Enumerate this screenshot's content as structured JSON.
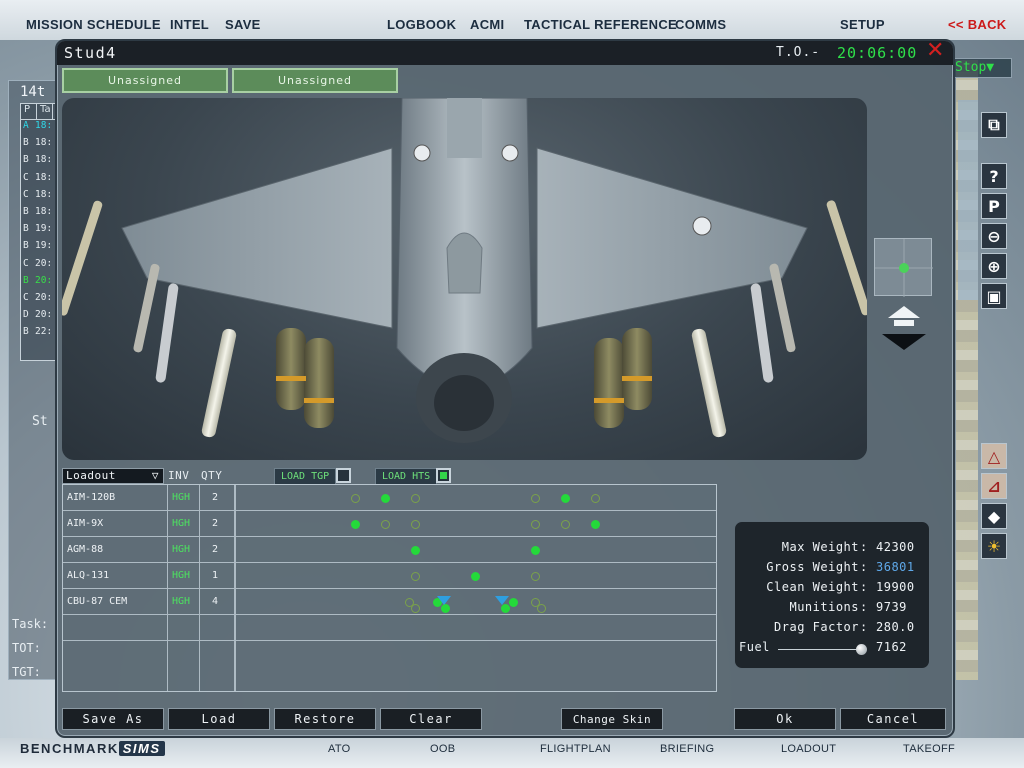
{
  "topnav": {
    "mission_schedule": "MISSION SCHEDULE",
    "intel": "INTEL",
    "save": "SAVE",
    "logbook": "LOGBOOK",
    "acmi": "ACMI",
    "tactical_reference": "TACTICAL REFERENCE",
    "comms": "COMMS",
    "setup": "SETUP",
    "back": "<< BACK"
  },
  "left_panel": {
    "title": "14t",
    "header": [
      "P",
      "Ta"
    ],
    "rows": [
      {
        "p": "A",
        "t": "18:",
        "color": "#2fd8e8"
      },
      {
        "p": "B",
        "t": "18:",
        "color": "#e6ecf0"
      },
      {
        "p": "B",
        "t": "18:",
        "color": "#e6ecf0"
      },
      {
        "p": "C",
        "t": "18:",
        "color": "#e6ecf0"
      },
      {
        "p": "C",
        "t": "18:",
        "color": "#e6ecf0"
      },
      {
        "p": "B",
        "t": "18:",
        "color": "#e6ecf0"
      },
      {
        "p": "B",
        "t": "19:",
        "color": "#e6ecf0"
      },
      {
        "p": "B",
        "t": "19:",
        "color": "#e6ecf0"
      },
      {
        "p": "C",
        "t": "20:",
        "color": "#e6ecf0"
      },
      {
        "p": "B",
        "t": "20:",
        "color": "#38e048"
      },
      {
        "p": "C",
        "t": "20:",
        "color": "#e6ecf0"
      },
      {
        "p": "D",
        "t": "20:",
        "color": "#e6ecf0"
      },
      {
        "p": "B",
        "t": "22:",
        "color": "#e6ecf0"
      }
    ],
    "st_label": "St",
    "task_label": "Task:",
    "tot_label": "TOT:",
    "tgt_label": "TGT:"
  },
  "right_side": {
    "stop_label": "Stop▼",
    "tools": [
      "resize-icon",
      "help-icon",
      "p-icon",
      "zoom-out-icon",
      "zoom-in-icon",
      "frame-icon",
      "profile-icon",
      "profile2-icon",
      "unit-icon",
      "weather-icon"
    ]
  },
  "dialog": {
    "title": "Stud4",
    "to_label": "T.O.-",
    "to_time": "20:06:00",
    "flight_buttons": [
      "Unassigned",
      "Unassigned"
    ]
  },
  "loadout": {
    "selector": "Loadout",
    "col_inv": "INV",
    "col_qty": "QTY",
    "load_tgp": "LOAD TGP",
    "load_tgp_checked": false,
    "load_hts": "LOAD HTS",
    "load_hts_checked": true,
    "rows": [
      {
        "name": "AIM-120B",
        "inv": "HGH",
        "qty": "2"
      },
      {
        "name": "AIM-9X",
        "inv": "HGH",
        "qty": "2"
      },
      {
        "name": "AGM-88",
        "inv": "HGH",
        "qty": "2"
      },
      {
        "name": "ALQ-131",
        "inv": "HGH",
        "qty": "1"
      },
      {
        "name": "CBU-87 CEM",
        "inv": "HGH",
        "qty": "4"
      }
    ]
  },
  "weights": {
    "max_weight_label": "Max Weight",
    "max_weight": "42300",
    "gross_weight_label": "Gross Weight",
    "gross_weight": "36801",
    "clean_weight_label": "Clean Weight",
    "clean_weight": "19900",
    "munitions_label": "Munitions",
    "munitions": "9739",
    "drag_factor_label": "Drag Factor",
    "drag_factor": "280.0",
    "fuel_label": "Fuel",
    "fuel": "7162"
  },
  "buttons": {
    "save_as": "Save As",
    "load": "Load",
    "restore": "Restore",
    "clear": "Clear",
    "change_skin": "Change Skin",
    "ok": "Ok",
    "cancel": "Cancel"
  },
  "footer": {
    "logo_main": "BENCHMARK",
    "logo_sims": "SIMS",
    "ato": "ATO",
    "oob": "OOB",
    "flightplan": "FLIGHTPLAN",
    "briefing": "BRIEFING",
    "loadout": "LOADOUT",
    "takeoff": "TAKEOFF"
  },
  "colors": {
    "accent_green": "#2fe04a",
    "close_red": "#d32020",
    "highlight_blue": "#5fa8e8"
  }
}
